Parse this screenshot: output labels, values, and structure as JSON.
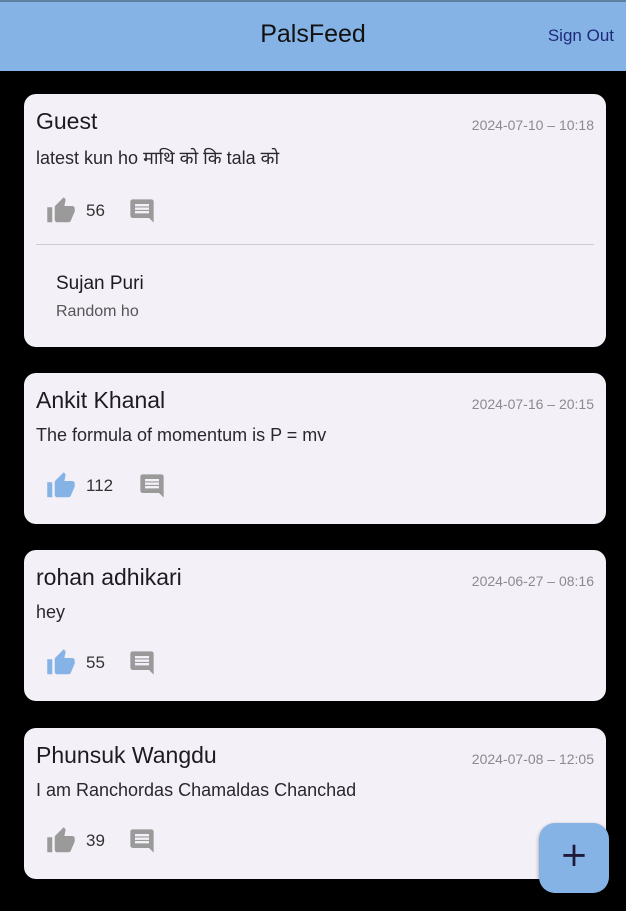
{
  "app": {
    "title": "PalsFeed",
    "sign_out_label": "Sign Out",
    "fab_label": "+"
  },
  "colors": {
    "appbar": "#86b3e6",
    "liked": "#86b3e6",
    "unliked": "#9a9a9a"
  },
  "posts": [
    {
      "author": "Guest",
      "time": "2024-07-10 – 10:18",
      "content": "latest kun ho माथि को कि tala को",
      "likes": "56",
      "liked": false,
      "comments": [
        {
          "author": "Sujan Puri",
          "text": "Random ho"
        }
      ]
    },
    {
      "author": "Ankit Khanal",
      "time": "2024-07-16 – 20:15",
      "content": "The formula of momentum is P = mv",
      "likes": "112",
      "liked": true
    },
    {
      "author": "rohan adhikari",
      "time": "2024-06-27 – 08:16",
      "content": "hey",
      "likes": "55",
      "liked": true
    },
    {
      "author": "Phunsuk Wangdu",
      "time": "2024-07-08 – 12:05",
      "content": "I am Ranchordas Chamaldas Chanchad",
      "likes": "39",
      "liked": false
    }
  ]
}
